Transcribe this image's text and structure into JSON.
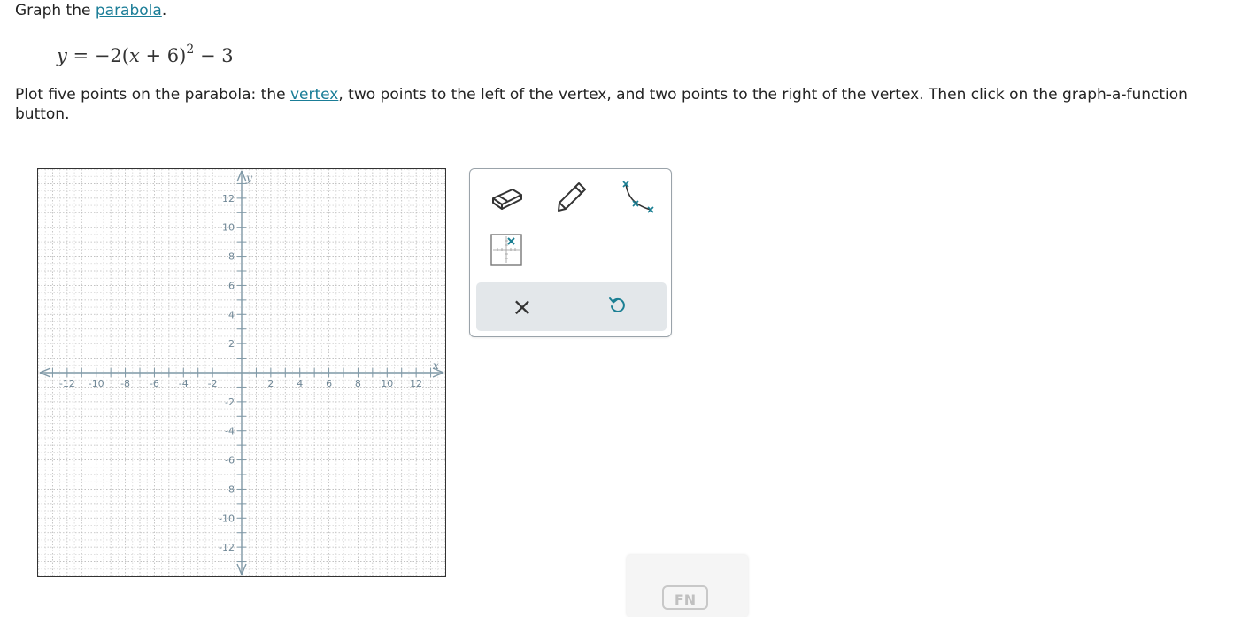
{
  "question": {
    "prefix": "Graph the ",
    "link_text": "parabola",
    "suffix": "."
  },
  "equation": {
    "lhs": "y",
    "eq": " = −2",
    "paren_open": "(",
    "var": "x",
    "inner": " + 6",
    "paren_close": ")",
    "exponent": "2",
    "tail": " − 3"
  },
  "instruction": {
    "part1": "Plot five points on the parabola: the ",
    "link_text": "vertex",
    "part2": ", two points to the left of the vertex, and two points to the right of the vertex. Then click on the graph-a-function button."
  },
  "graph": {
    "x_axis_label": "x",
    "y_axis_label": "y",
    "x_range": [
      -14,
      14
    ],
    "y_range": [
      -14,
      14
    ],
    "x_tick_labels": [
      "-12",
      "-10",
      "-8",
      "-6",
      "-4",
      "-2",
      "2",
      "4",
      "6",
      "8",
      "10",
      "12"
    ],
    "y_tick_labels": [
      "12",
      "10",
      "8",
      "6",
      "4",
      "2",
      "-2",
      "-4",
      "-6",
      "-8",
      "-10",
      "-12"
    ],
    "grid": "dotted",
    "axis_color": "#7f98a6"
  },
  "tools": {
    "eraser": "eraser-icon",
    "pencil": "pencil-icon",
    "curve": "parabola-curve-icon",
    "point_grid": "point-grid-icon",
    "clear": "×",
    "undo": "undo-icon"
  },
  "fn_button": {
    "label": "FN"
  },
  "colors": {
    "link": "#1a7d97",
    "teal": "#1b7f93",
    "panel_bar": "#e3e7ea"
  }
}
